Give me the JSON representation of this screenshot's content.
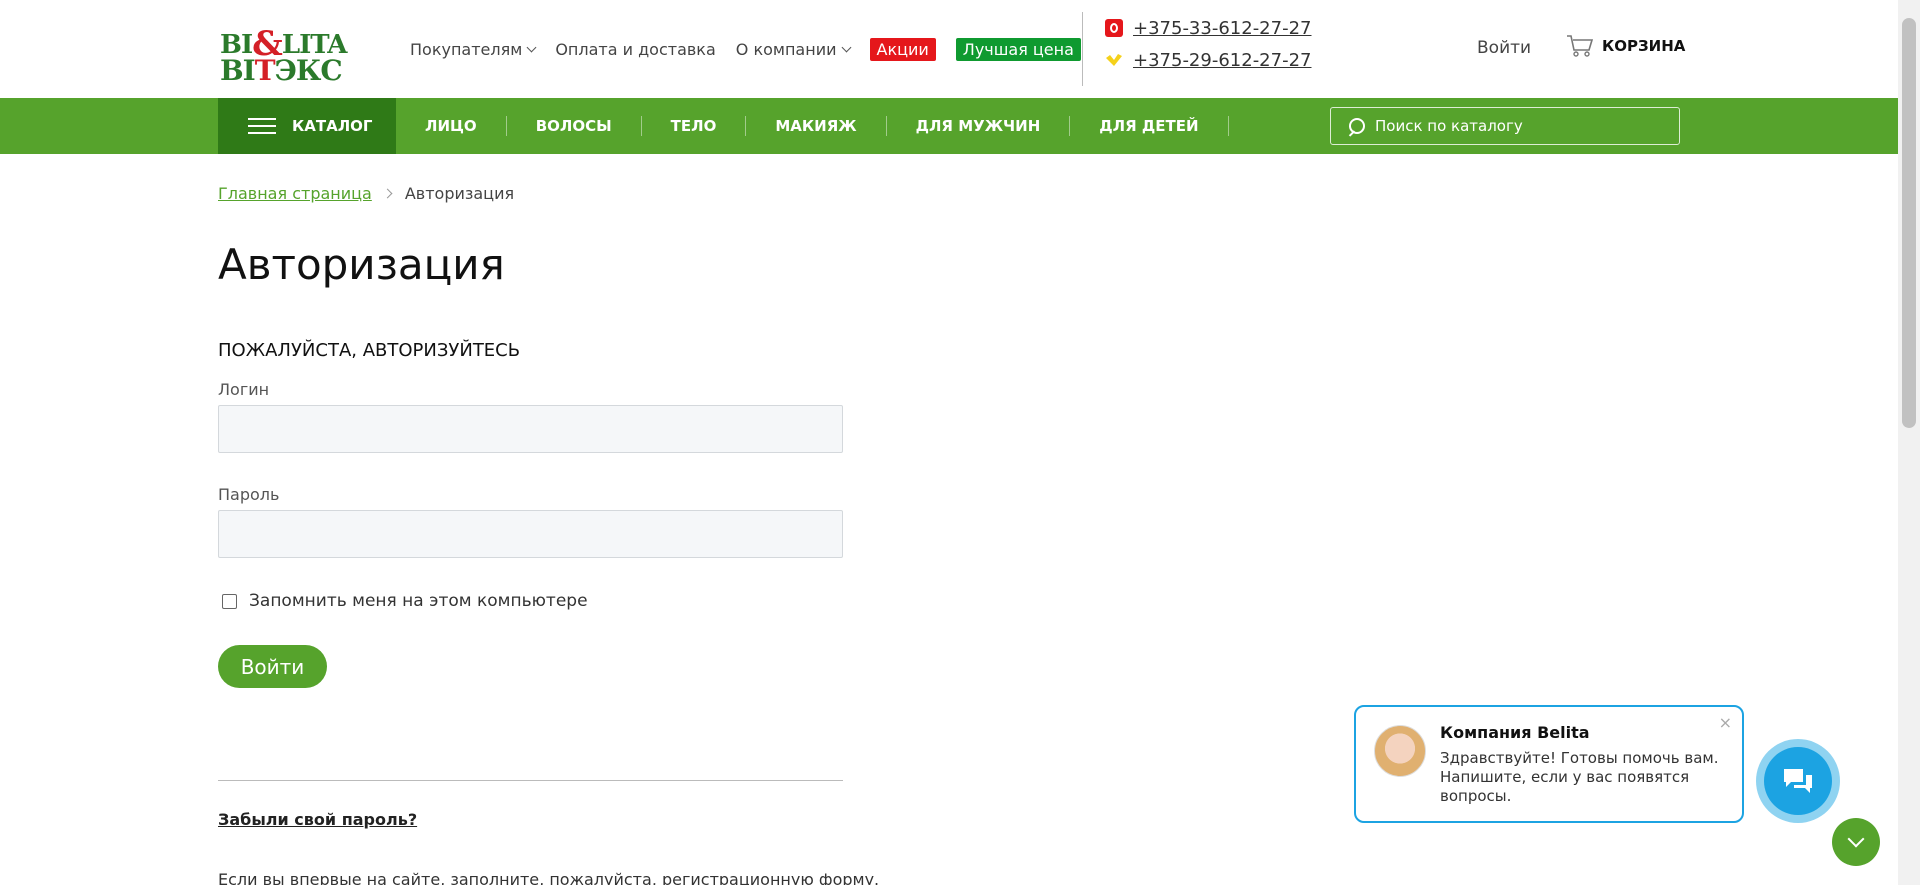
{
  "logo": {
    "line1_a": "BI",
    "line1_amp": "&",
    "line1_b": "LITA",
    "line2_a": "BI",
    "line2_r": "T",
    "line2_b": "ЭКС"
  },
  "topnav": {
    "items": [
      {
        "label": "Покупателям",
        "dropdown": true
      },
      {
        "label": "Оплата и доставка",
        "dropdown": false
      },
      {
        "label": "О компании",
        "dropdown": true
      }
    ],
    "badges": [
      {
        "label": "Акции",
        "color": "#e5171b"
      },
      {
        "label": "Лучшая цена",
        "color": "#0f9a30"
      }
    ]
  },
  "phones": [
    "+375-33-612-27-27",
    "+375-29-612-27-27"
  ],
  "header": {
    "login": "Войти",
    "cart": "КОРЗИНА"
  },
  "greennav": {
    "catalog": "КАТАЛОГ",
    "categories": [
      "ЛИЦО",
      "ВОЛОСЫ",
      "ТЕЛО",
      "МАКИЯЖ",
      "ДЛЯ МУЖЧИН",
      "ДЛЯ ДЕТЕЙ"
    ],
    "search_placeholder": "Поиск по каталогу",
    "color": "#56a32c"
  },
  "breadcrumb": {
    "home": "Главная страница",
    "current": "Авторизация"
  },
  "main": {
    "title": "Авторизация",
    "subhead": "ПОЖАЛУЙСТА, АВТОРИЗУЙТЕСЬ",
    "login_label": "Логин",
    "password_label": "Пароль",
    "login_value": "",
    "password_value": "",
    "remember_label": "Запомнить меня на этом компьютере",
    "submit": "Войти",
    "forgot": "Забыли свой пароль?",
    "register_text": "Если вы впервые на сайте, заполните, пожалуйста, регистрационную форму."
  },
  "chat": {
    "title": "Компания Belita",
    "text": "Здравствуйте! Готовы помочь вам. Напишите, если у вас появятся вопросы.",
    "close": "×"
  }
}
